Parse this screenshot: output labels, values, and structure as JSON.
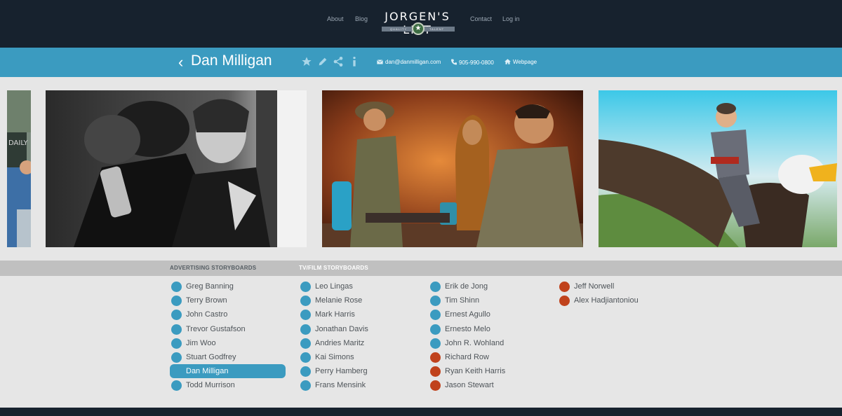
{
  "nav": {
    "links": [
      "About",
      "Blog",
      "Contact",
      "Log in"
    ],
    "logo_title": "JORGEN'S LIST",
    "logo_tag_left": "QUALITY",
    "logo_tag_right": "TALENT"
  },
  "profile": {
    "name": "Dan Milligan",
    "email": "dan@danmilligan.com",
    "phone": "905-990-0800",
    "webpage": "Webpage",
    "icons": [
      "star-icon",
      "pencil-icon",
      "share-icon",
      "info-icon",
      "envelope-icon",
      "phone-icon",
      "home-icon",
      "chevron-left-icon"
    ]
  },
  "gallery": {
    "images": [
      "storyboard-partial-left",
      "storyboard-soldiers-bw",
      "storyboard-explorer-tomb",
      "storyboard-aviator-eagle"
    ]
  },
  "categories": [
    "ADVERTISING STORYBOARDS",
    "TV/FILM STORYBOARDS"
  ],
  "active_category": "ADVERTISING STORYBOARDS",
  "colors": {
    "available": "#3b9bc0",
    "unavailable": "#c0421c",
    "header": "#17222e",
    "accent": "#3b9bc0"
  },
  "roster": [
    [
      {
        "name": "Greg Banning",
        "status": "available"
      },
      {
        "name": "Terry Brown",
        "status": "available"
      },
      {
        "name": "John Castro",
        "status": "available"
      },
      {
        "name": "Trevor Gustafson",
        "status": "available"
      },
      {
        "name": "Jim Woo",
        "status": "available"
      },
      {
        "name": "Stuart Godfrey",
        "status": "available"
      },
      {
        "name": "Dan Milligan",
        "status": "available",
        "selected": true
      },
      {
        "name": "Todd Murrison",
        "status": "available"
      }
    ],
    [
      {
        "name": "Leo Lingas",
        "status": "available"
      },
      {
        "name": "Melanie Rose",
        "status": "available"
      },
      {
        "name": "Mark Harris",
        "status": "available"
      },
      {
        "name": "Jonathan Davis",
        "status": "available"
      },
      {
        "name": "Andries Maritz",
        "status": "available"
      },
      {
        "name": "Kai Simons",
        "status": "available"
      },
      {
        "name": "Perry Hamberg",
        "status": "available"
      },
      {
        "name": "Frans Mensink",
        "status": "available"
      }
    ],
    [
      {
        "name": "Erik de Jong",
        "status": "available"
      },
      {
        "name": "Tim Shinn",
        "status": "available"
      },
      {
        "name": "Ernest Agullo",
        "status": "available"
      },
      {
        "name": "Ernesto Melo",
        "status": "available"
      },
      {
        "name": "John R. Wohland",
        "status": "available"
      },
      {
        "name": "Richard Row",
        "status": "unavailable"
      },
      {
        "name": "Ryan Keith Harris",
        "status": "unavailable"
      },
      {
        "name": "Jason Stewart",
        "status": "unavailable"
      }
    ],
    [
      {
        "name": "Jeff Norwell",
        "status": "unavailable"
      },
      {
        "name": "Alex Hadjiantoniou",
        "status": "unavailable"
      }
    ]
  ]
}
